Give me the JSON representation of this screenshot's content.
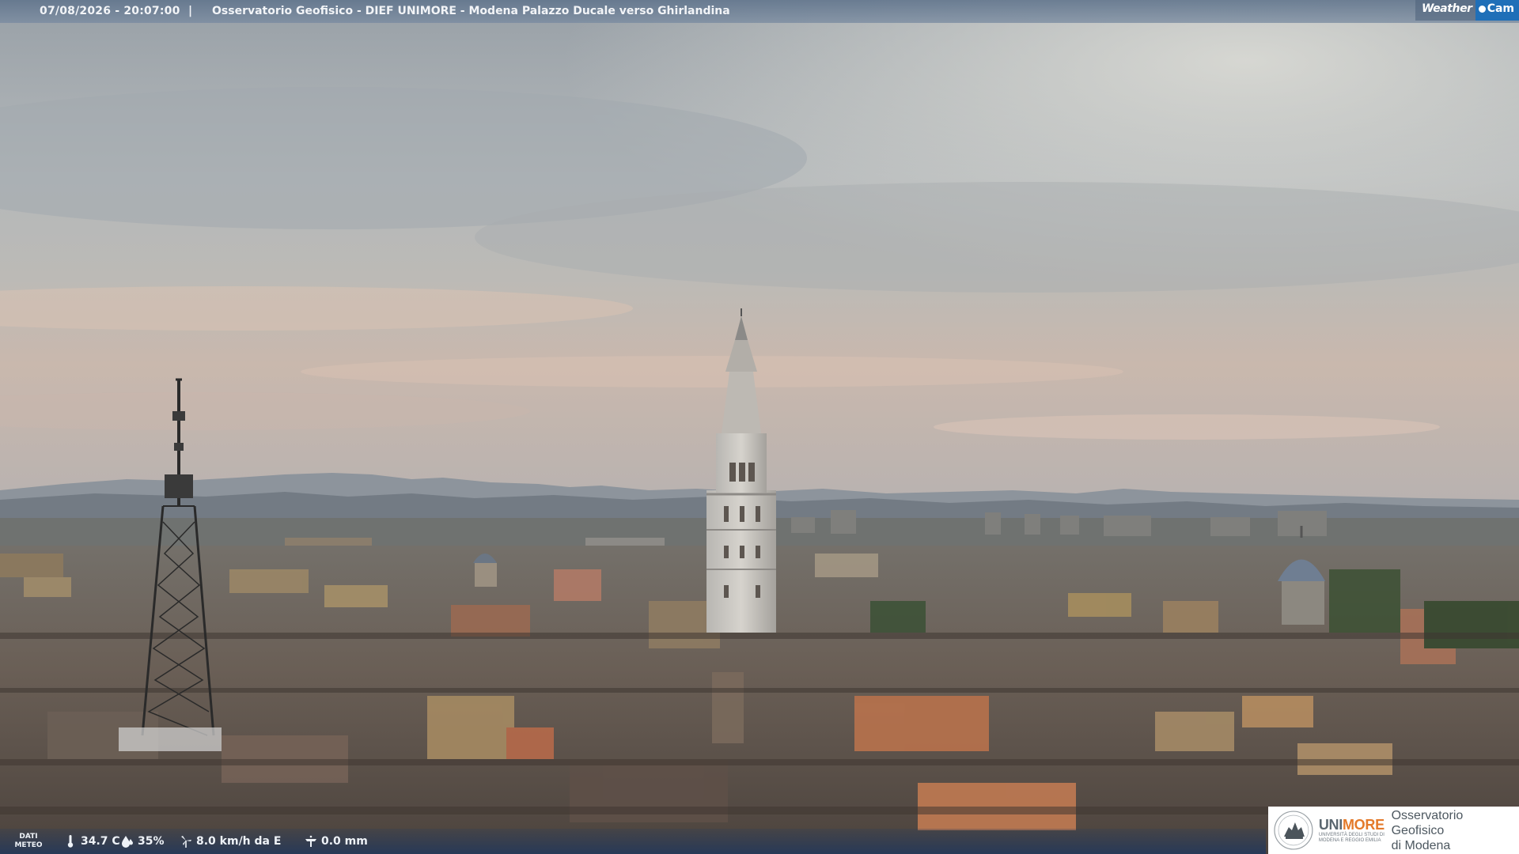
{
  "header": {
    "timestamp": "07/08/2026 - 20:07:00",
    "separator": "|",
    "camera_title": "Osservatorio Geofisico - DIEF UNIMORE - Modena Palazzo Ducale verso Ghirlandina"
  },
  "brand": {
    "weather": "Weather",
    "cam": "Cam"
  },
  "weather_bar": {
    "label_line1": "DATI",
    "label_line2": "METEO",
    "temperature": "34.7 C",
    "temperature_icon": "thermometer-icon",
    "humidity": "35%",
    "humidity_icon": "humidity-drop-icon",
    "wind": "8.0 km/h da E",
    "wind_icon": "wind-turbine-icon",
    "rain": "0.0 mm",
    "rain_icon": "rain-gauge-icon"
  },
  "institution": {
    "uni_prefix": "UNI",
    "uni_suffix": "MORE",
    "uni_subtitle": "UNIVERSITÀ DEGLI STUDI DI MODENA E REGGIO EMILIA",
    "observatory_line1": "Osservatorio Geofisico",
    "observatory_line2": "di Modena",
    "seal_icon": "university-seal-icon"
  },
  "colors": {
    "topbar": "#60748c",
    "brand_blue": "#1f6fb8",
    "unimore_orange": "#e47a2a",
    "sky": "#a9b0b5",
    "roofs": "#5e544c"
  }
}
